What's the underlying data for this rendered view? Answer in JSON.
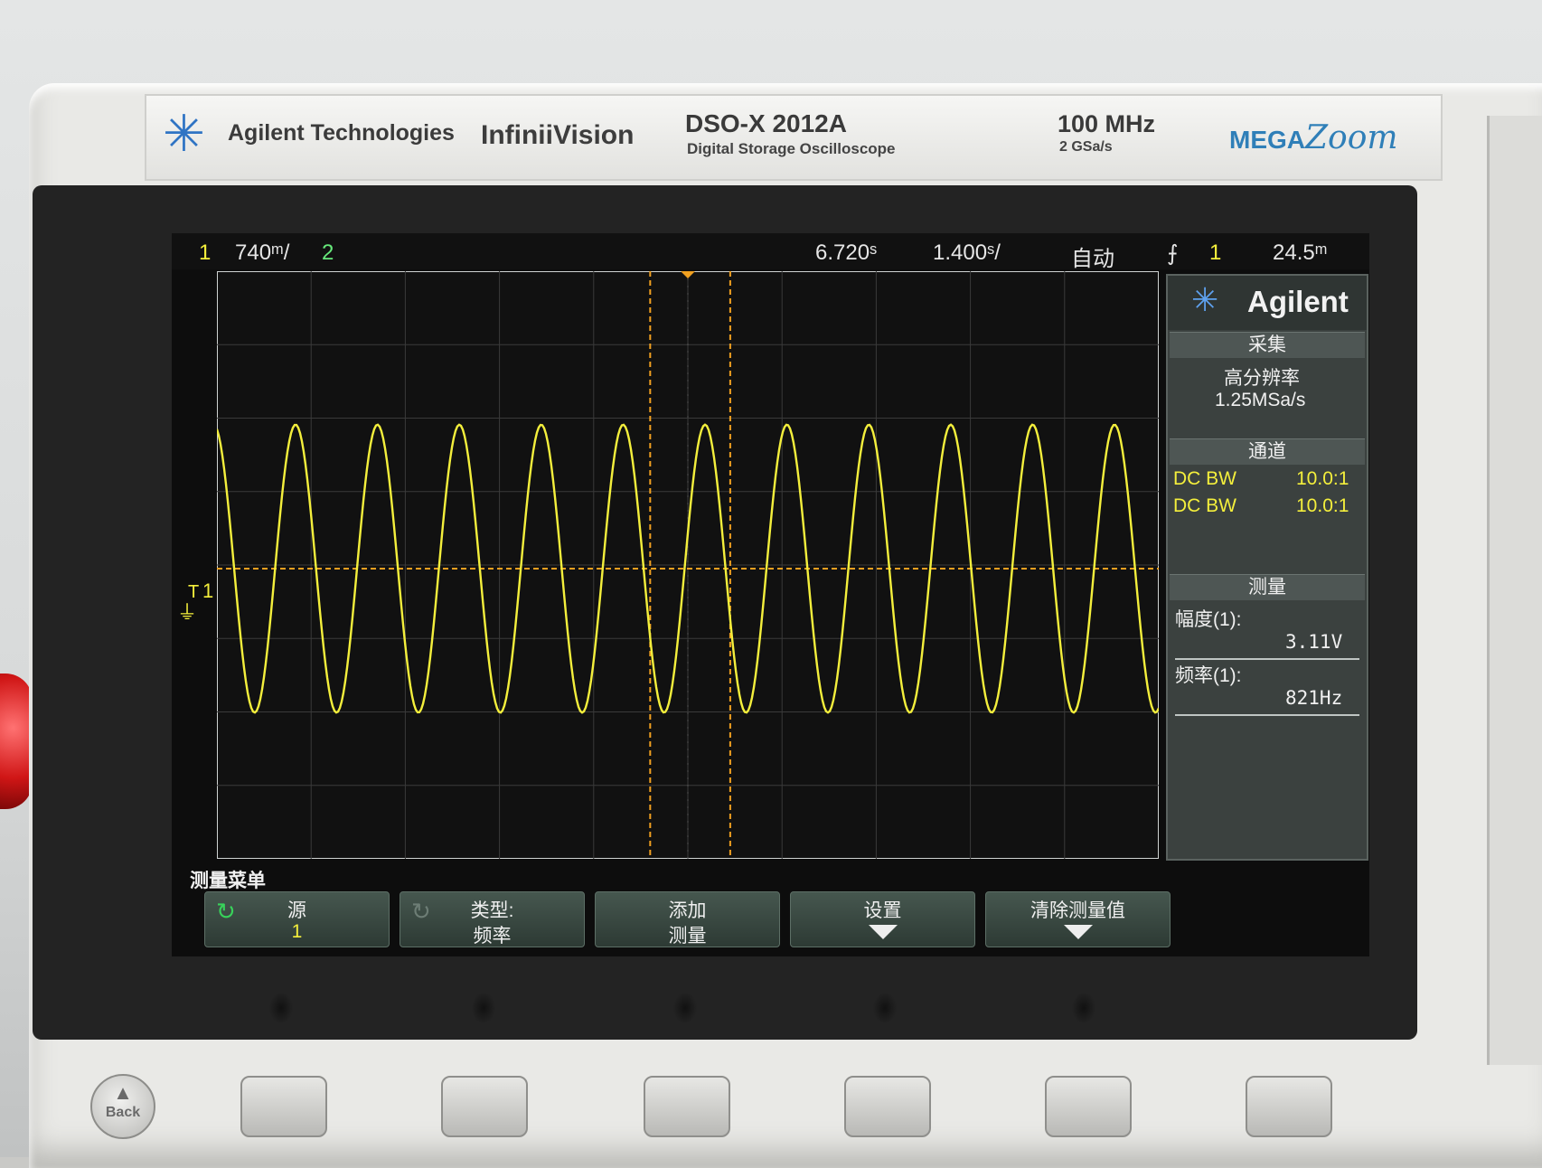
{
  "device": {
    "brand": "Agilent Technologies",
    "series": "InfiniiVision",
    "model": "DSO-X 2012A",
    "model_subtitle": "Digital Storage Oscilloscope",
    "bandwidth": "100 MHz",
    "sample_rate": "2 GSa/s",
    "megazoom_a": "MEGA",
    "megazoom_b": "Zoom"
  },
  "status_bar": {
    "ch1_num": "1",
    "ch1_scale": "740ᵐ/",
    "ch2_num": "2",
    "time_delay": "6.720ˢ",
    "time_scale": "1.400ˢ/",
    "trigger_mode": "自动",
    "trigger_slope": "⨍",
    "trigger_source": "1",
    "trigger_level": "24.5ᵐ"
  },
  "side_panel": {
    "logo": "Agilent",
    "acq_title": "采集",
    "acq_mode": "高分辨率",
    "acq_rate": "1.25MSa/s",
    "channel_title": "通道",
    "channels": [
      {
        "coupling": "DC BW",
        "probe": "10.0:1"
      },
      {
        "coupling": "DC BW",
        "probe": "10.0:1"
      }
    ],
    "meas_title": "测量",
    "measurements": [
      {
        "label": "幅度(1):",
        "value": "3.11V"
      },
      {
        "label": "频率(1):",
        "value": "821Hz"
      }
    ]
  },
  "markers": {
    "ch1_marker": "1",
    "trigger_marker": "T"
  },
  "softkey_menu": {
    "title": "测量菜单",
    "keys": [
      {
        "line1": "源",
        "line2": "1"
      },
      {
        "line1": "类型:",
        "line2": "频率"
      },
      {
        "line1": "添加",
        "line2": "测量"
      },
      {
        "line1": "设置",
        "line2": ""
      },
      {
        "line1": "清除测量值",
        "line2": ""
      }
    ]
  },
  "front_panel": {
    "back_label": "Back"
  },
  "colors": {
    "channel1": "#f4ef3c",
    "cursor": "#f0a020",
    "grid": "#3a3a3a"
  },
  "waveform": {
    "cycles_on_screen": 11.5,
    "amplitude_fraction_of_screen": 0.49
  }
}
